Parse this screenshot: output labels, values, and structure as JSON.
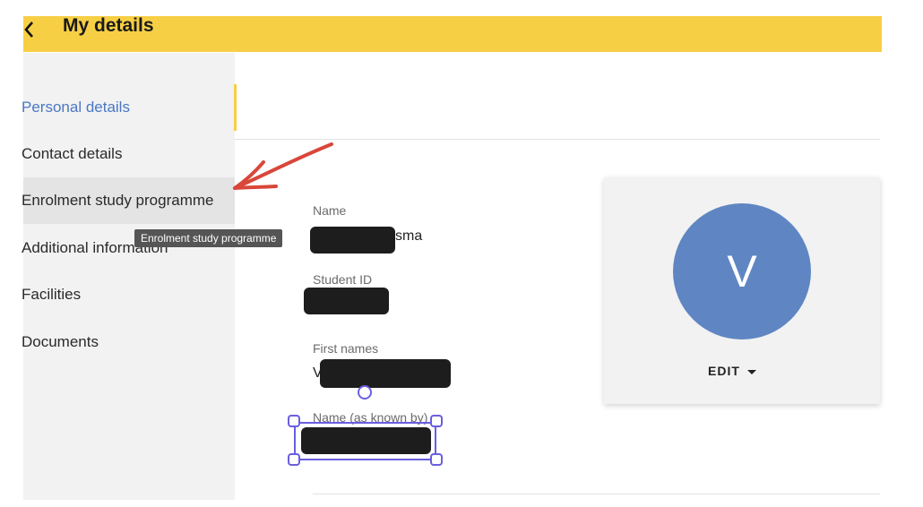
{
  "header": {
    "title": "My details",
    "back_icon": "chevron-left-icon",
    "color": "#f7cf45"
  },
  "sidebar": {
    "items": [
      {
        "label": "Personal details",
        "state": "active"
      },
      {
        "label": "Contact details"
      },
      {
        "label": "Enrolment study programme",
        "state": "hover"
      },
      {
        "label": "Additional information"
      },
      {
        "label": "Facilities"
      },
      {
        "label": "Documents"
      }
    ],
    "tooltip": "Enrolment study programme"
  },
  "fields": [
    {
      "label": "Name",
      "value_suffix": "sma"
    },
    {
      "label": "Student ID"
    },
    {
      "label": "First names",
      "value_prefix": "V"
    },
    {
      "label": "Name (as known by)"
    }
  ],
  "avatar": {
    "initial": "V",
    "color": "#5f86c3",
    "edit_label": "EDIT"
  },
  "annotation": {
    "type": "arrow",
    "color": "#d9463a"
  }
}
